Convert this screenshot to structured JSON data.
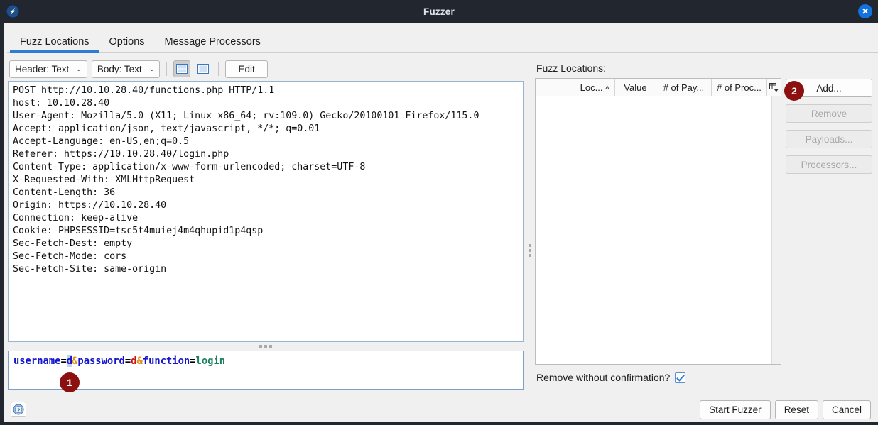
{
  "window": {
    "title": "Fuzzer",
    "app_icon": "zap-logo-icon",
    "close_label": "✕"
  },
  "tabs": [
    {
      "label": "Fuzz Locations",
      "active": true
    },
    {
      "label": "Options",
      "active": false
    },
    {
      "label": "Message Processors",
      "active": false
    }
  ],
  "toolbar": {
    "header_combo": "Header: Text",
    "body_combo": "Body: Text",
    "chevron": "⌄",
    "view_split_icon": "split-view-icon",
    "view_single_icon": "single-view-icon",
    "edit_label": "Edit"
  },
  "request": {
    "text": "POST http://10.10.28.40/functions.php HTTP/1.1\nhost: 10.10.28.40\nUser-Agent: Mozilla/5.0 (X11; Linux x86_64; rv:109.0) Gecko/20100101 Firefox/115.0\nAccept: application/json, text/javascript, */*; q=0.01\nAccept-Language: en-US,en;q=0.5\nReferer: https://10.10.28.40/login.php\nContent-Type: application/x-www-form-urlencoded; charset=UTF-8\nX-Requested-With: XMLHttpRequest\nContent-Length: 36\nOrigin: https://10.10.28.40\nConnection: keep-alive\nCookie: PHPSESSID=tsc5t4muiej4m4qhupid1p4qsp\nSec-Fetch-Dest: empty\nSec-Fetch-Mode: cors\nSec-Fetch-Site: same-origin"
  },
  "body": {
    "raw": "username=d&password=d&function=login",
    "tokens": {
      "k1": "username",
      "eq1": "=",
      "v1": "d",
      "amp1": "&",
      "k2": "password",
      "eq2": "=",
      "v2": "d",
      "amp2": "&",
      "k3": "function",
      "eq3": "=",
      "v3": "login"
    },
    "colors": {
      "key": "#1414cc",
      "equals": "#000000",
      "ampersand": "#e08a13",
      "value_selected": "#1414cc",
      "selection_bg": "#c5d4f2",
      "value_red": "#cc1111",
      "value_green": "#1a7f5a"
    }
  },
  "fuzz_panel": {
    "label": "Fuzz Locations:",
    "columns": [
      "",
      "Loc...",
      "Value",
      "# of Pay...",
      "# of Proc..."
    ],
    "sort_caret": "∧",
    "column_config_icon": "table-column-settings-icon",
    "rows": [],
    "buttons": [
      {
        "label": "Add...",
        "enabled": true
      },
      {
        "label": "Remove",
        "enabled": false
      },
      {
        "label": "Payloads...",
        "enabled": false
      },
      {
        "label": "Processors...",
        "enabled": false
      }
    ],
    "remove_confirm": {
      "label": "Remove without confirmation?",
      "checked": true
    }
  },
  "footer": {
    "help_icon": "help-question-icon",
    "start_label": "Start Fuzzer",
    "reset_label": "Reset",
    "cancel_label": "Cancel"
  },
  "annotations": [
    {
      "id": "1",
      "target": "body-text-field"
    },
    {
      "id": "2",
      "target": "add-button"
    }
  ],
  "theme": {
    "titlebar_bg": "#22262f",
    "accent": "#2d7dd2",
    "badge_bg": "#8c1010",
    "panel_bg": "#f0f0f0"
  }
}
